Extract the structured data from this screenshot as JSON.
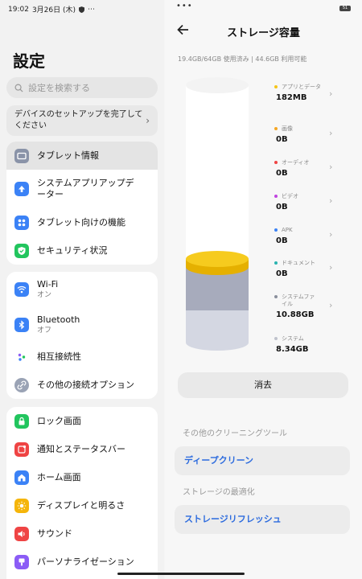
{
  "status": {
    "time": "19:02",
    "date": "3月26日 (木)",
    "more": "⋯"
  },
  "settings": {
    "title": "設定",
    "search_placeholder": "設定を検索する",
    "setup_text": "デバイスのセットアップを完了してください",
    "groups": [
      {
        "items": [
          {
            "label": "タブレット情報",
            "icon": "tablet-icon",
            "color": "#8a93a8",
            "selected": true
          },
          {
            "label": "システムアプリアップデーター",
            "icon": "arrow-up-icon",
            "color": "#3b82f6"
          },
          {
            "label": "タブレット向けの機能",
            "icon": "grid-icon",
            "color": "#3b82f6"
          },
          {
            "label": "セキュリティ状況",
            "icon": "shield-check-icon",
            "color": "#22c55e"
          }
        ]
      },
      {
        "items": [
          {
            "label": "Wi-Fi",
            "sub": "オン",
            "icon": "wifi-icon",
            "color": "#3b82f6"
          },
          {
            "label": "Bluetooth",
            "sub": "オフ",
            "icon": "bluetooth-icon",
            "color": "#3b82f6"
          },
          {
            "label": "相互接続性",
            "icon": "connect-dots-icon",
            "color": "#ffffff"
          },
          {
            "label": "その他の接続オプション",
            "icon": "link-icon",
            "color": "#9aa3b5"
          }
        ]
      },
      {
        "items": [
          {
            "label": "ロック画面",
            "icon": "lock-icon",
            "color": "#22c55e"
          },
          {
            "label": "通知とステータスバー",
            "icon": "notification-icon",
            "color": "#ef4444"
          },
          {
            "label": "ホーム画面",
            "icon": "home-icon",
            "color": "#3b82f6"
          },
          {
            "label": "ディスプレイと明るさ",
            "icon": "sun-icon",
            "color": "#f5b50a"
          },
          {
            "label": "サウンド",
            "icon": "speaker-icon",
            "color": "#ef4444"
          },
          {
            "label": "パーソナライゼーション",
            "icon": "brush-icon",
            "color": "#8b5cf6"
          }
        ]
      }
    ]
  },
  "storage": {
    "title": "ストレージ容量",
    "usage": "19.4GB/64GB 使用済み | 44.6GB 利用可能",
    "battery": "51",
    "legend": [
      {
        "name": "アプリとデータ",
        "value": "182MB",
        "color": "#f5c518"
      },
      {
        "name": "画像",
        "value": "0B",
        "color": "#f5a623"
      },
      {
        "name": "オーディオ",
        "value": "0B",
        "color": "#ef4444"
      },
      {
        "name": "ビデオ",
        "value": "0B",
        "color": "#c044e0"
      },
      {
        "name": "APK",
        "value": "0B",
        "color": "#3b82f6"
      },
      {
        "name": "ドキュメント",
        "value": "0B",
        "color": "#2ab3b0"
      },
      {
        "name": "システムファイル",
        "value": "10.88GB",
        "color": "#8a8f9c"
      },
      {
        "name": "システム",
        "value": "8.34GB",
        "color": "#bfc2cc"
      }
    ],
    "clear_label": "消去",
    "other_tools_label": "その他のクリーニングツール",
    "deep_clean_label": "ディープクリーン",
    "optimize_label": "ストレージの最適化",
    "refresh_label": "ストレージリフレッシュ"
  }
}
